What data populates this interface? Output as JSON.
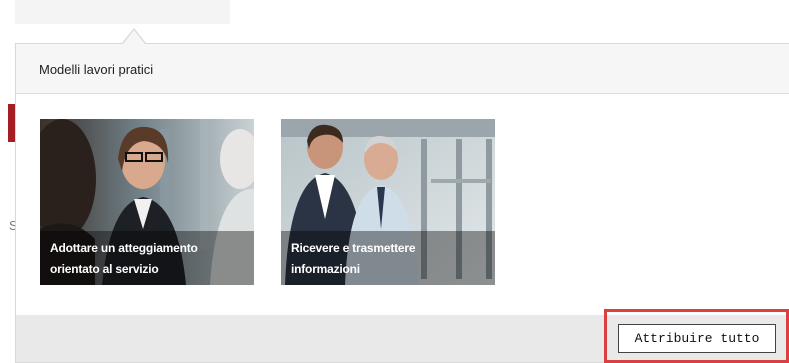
{
  "background": {
    "partial_letter": "S"
  },
  "popover": {
    "title": "Modelli lavori pratici",
    "cards": [
      {
        "title": "Adottare un atteggiamento orientato al servizio",
        "image": "office-woman-smiling-photo"
      },
      {
        "title": "Ricevere e trasmettere informazioni",
        "image": "two-businessmen-talking-photo"
      }
    ],
    "footer": {
      "assign_all_label": "Attribuire tutto"
    }
  },
  "colors": {
    "brand_red": "#a51e22",
    "highlight_red": "#d9403f"
  }
}
